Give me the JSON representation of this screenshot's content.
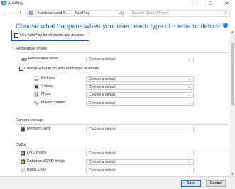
{
  "window": {
    "title": "AutoPlay",
    "controls": {
      "minimize": "—",
      "maximize": "☐",
      "close": "✕"
    }
  },
  "nav": {
    "back": "←",
    "forward": "→",
    "up": "↑",
    "breadcrumb": [
      "« Hardware and S...",
      "AutoPlay"
    ],
    "breadcrumb_separator": "›",
    "dropdown_caret": "⌄",
    "refresh": "↻",
    "search_placeholder": "Search Control Panel",
    "search_icon": "⌕"
  },
  "main": {
    "heading": "Choose what happens when you insert each type of media or device",
    "help": "?",
    "use_autoplay": {
      "label": "Use AutoPlay for all media and devices",
      "checked": false
    }
  },
  "removable": {
    "section": "Removable drives",
    "drive_label": "Removable drive",
    "drive_value": "Choose a default",
    "per_type": {
      "label": "Choose what to do with each type of media",
      "checked": false
    },
    "types": [
      {
        "label": "Pictures",
        "value": "Choose a default",
        "icon": "pictures-icon"
      },
      {
        "label": "Videos",
        "value": "Choose a default",
        "icon": "videos-icon"
      },
      {
        "label": "Music",
        "value": "Choose a default",
        "icon": "music-icon"
      },
      {
        "label": "Mixed content",
        "value": "Choose a default",
        "icon": "mixed-content-icon"
      }
    ]
  },
  "camera": {
    "section": "Camera storage",
    "label": "Memory card",
    "value": "Choose a default"
  },
  "dvds": {
    "section": "DVDs",
    "items": [
      {
        "label": "DVD movie",
        "value": "Choose a default"
      },
      {
        "label": "Enhanced DVD movie",
        "value": "Choose a default"
      },
      {
        "label": "Blank DVD",
        "value": "Choose a default"
      }
    ]
  },
  "footer": {
    "save": "Save",
    "cancel": "Cancel"
  },
  "scroll": {
    "up": "▲",
    "down": "▼",
    "position": 0.1
  },
  "colors": {
    "accent": "#1a5fb4",
    "highlight_box": "#1a4fa0",
    "footer_bg": "#f0f0f0"
  }
}
